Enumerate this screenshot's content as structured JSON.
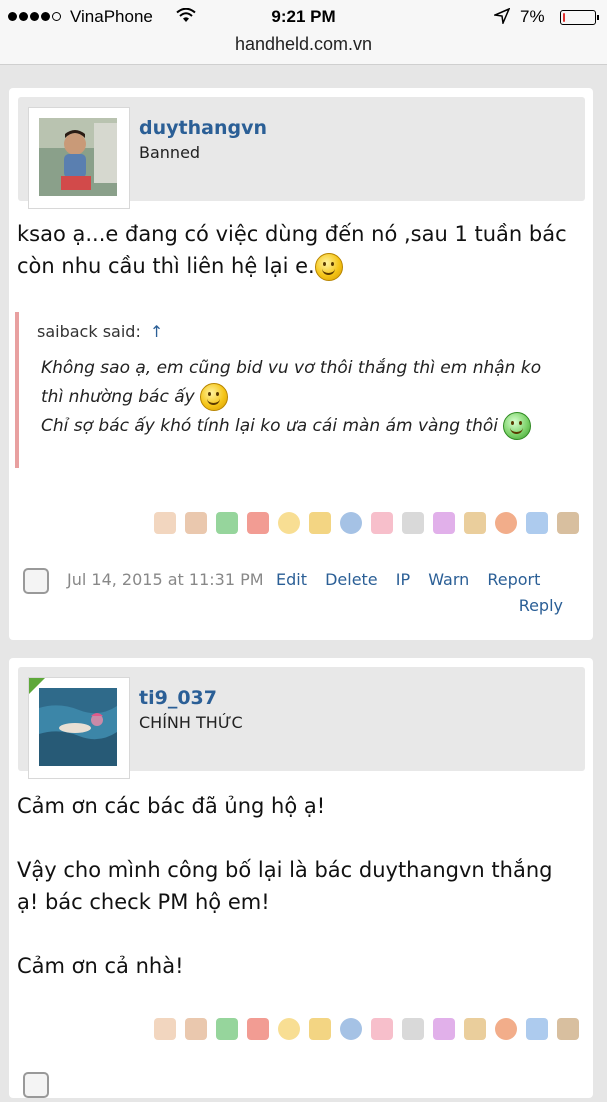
{
  "status_bar": {
    "carrier": "VinaPhone",
    "time": "9:21 PM",
    "battery": "7%",
    "battery_level": 0.07,
    "url": "handheld.com.vn"
  },
  "posts": [
    {
      "username": "duythangvn",
      "user_title": "Banned",
      "message_line1": "ksao ạ...e đang có việc dùng đến nó ,sau 1 tuần bác",
      "message_line2": "còn nhu cầu thì liên hệ lại e.",
      "quote": {
        "author": "saiback said:",
        "arrow": "↑",
        "line1": "Không sao ạ, em cũng bid vu vơ thôi thắng thì em nhận ko",
        "line2": "thì nhường bác ấy",
        "line3": "Chỉ sợ bác ấy khó tính lại ko ưa cái màn ám vàng thôi"
      },
      "date": "Jul 14, 2015 at 11:31 PM",
      "actions": [
        "Edit",
        "Delete",
        "IP",
        "Warn",
        "Report"
      ],
      "reply": "Reply"
    },
    {
      "username": "ti9_037",
      "user_title": "CHÍNH THỨC",
      "message_p1": "Cảm ơn các bác đã ủng hộ ạ!",
      "message_p2_line1": "Vậy cho mình công bố lại là bác duythangvn thắng",
      "message_p2_line2": "ạ! bác check PM hộ em!",
      "message_p3": "Cảm ơn cả nhà!"
    }
  ],
  "reaction_icons": [
    "like-icon",
    "dislike-icon",
    "agree-icon",
    "disagree-icon",
    "funny-icon",
    "winner-icon",
    "informative-icon",
    "love-icon",
    "useful-icon",
    "rainbow-icon",
    "creative-icon",
    "late-icon",
    "spelling-icon",
    "archive-icon"
  ],
  "reaction_colors": [
    "#e8b48a",
    "#d99a6c",
    "#3fb34a",
    "#e84a3a",
    "#f2c23a",
    "#e9b21e",
    "#5b8fd0",
    "#f08aa0",
    "#b9b9b9",
    "#c96fd8",
    "#d8a64a",
    "#e86a2a",
    "#6aa0e0",
    "#b88a50"
  ]
}
